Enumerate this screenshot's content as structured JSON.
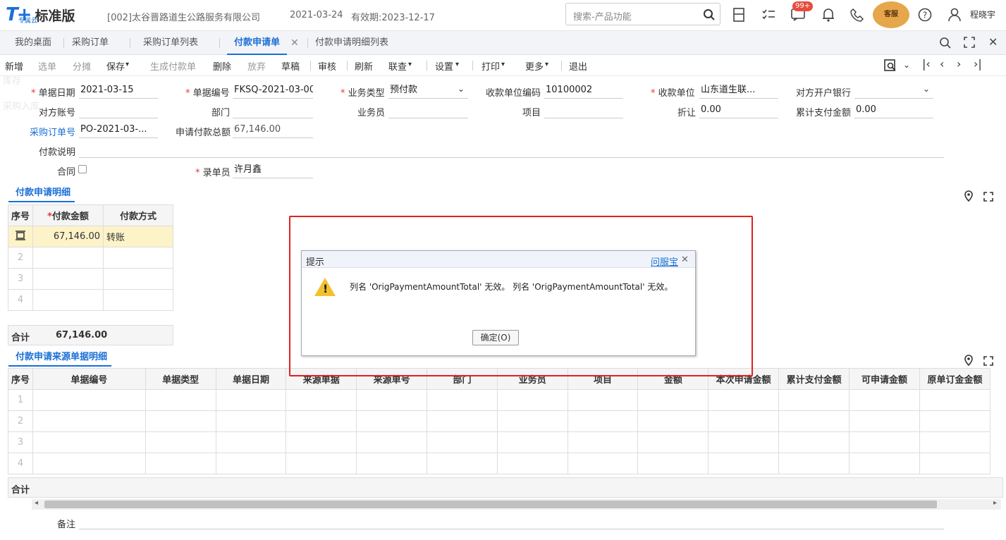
{
  "header": {
    "logo": "T+",
    "logo_sub": "专属云",
    "edition": "标准版",
    "company": "[002]太谷晋路道生公路服务有限公司",
    "date": "2021-03-24",
    "validity": "有效期:2023-12-17",
    "search_placeholder": "搜索-产品功能",
    "badge": "99+",
    "mascot": "客服",
    "user": "程晓宇"
  },
  "tabs": [
    "我的桌面",
    "采购订单",
    "采购订单列表",
    "付款申请单",
    "付款申请明细列表"
  ],
  "toolbar": [
    "新增",
    "选单",
    "分摊",
    "保存",
    "生成付款单",
    "删除",
    "放弃",
    "草稿",
    "审核",
    "刷新",
    "联查",
    "设置",
    "打印",
    "更多",
    "退出"
  ],
  "form": {
    "date_l": "单据日期",
    "date_v": "2021-03-15",
    "no_l": "单据编号",
    "no_v": "FKSQ-2021-03-00...",
    "biz_l": "业务类型",
    "biz_v": "预付款",
    "payee_code_l": "收款单位编码",
    "payee_code_v": "10100002",
    "payee_l": "收款单位",
    "payee_v": "山东道生联...",
    "bank_l": "对方开户银行",
    "bank_v": "",
    "acct_l": "对方账号",
    "dept_l": "部门",
    "staff_l": "业务员",
    "proj_l": "项目",
    "disc_l": "折让",
    "disc_v": "0.00",
    "cum_l": "累计支付金额",
    "cum_v": "0.00",
    "po_l": "采购订单号",
    "po_v": "PO-2021-03-...",
    "total_l": "申请付款总额",
    "total_v": "67,146.00",
    "note_l": "付款说明",
    "contract_l": "合同",
    "entry_l": "录单员",
    "entry_v": "许月鑫"
  },
  "detail": {
    "title": "付款申请明细",
    "headers": [
      "序号",
      "付款金额",
      "付款方式"
    ],
    "rows": [
      {
        "no": "",
        "amt": "67,146.00",
        "way": "转账"
      },
      {
        "no": "2",
        "amt": "",
        "way": ""
      },
      {
        "no": "3",
        "amt": "",
        "way": ""
      },
      {
        "no": "4",
        "amt": "",
        "way": ""
      }
    ],
    "sum_label": "合计",
    "sum_value": "67,146.00"
  },
  "source": {
    "title": "付款申请来源单据明细",
    "headers": [
      "序号",
      "单据编号",
      "单据类型",
      "单据日期",
      "来源单据",
      "来源单号",
      "部门",
      "业务员",
      "项目",
      "金额",
      "本次申请金额",
      "累计支付金额",
      "可申请金额",
      "原单订金金额"
    ],
    "rows": [
      "1",
      "2",
      "3",
      "4"
    ],
    "sum_label": "合计"
  },
  "remark_l": "备注",
  "dialog": {
    "title": "提示",
    "help": "问服宝",
    "message": "列名 'OrigPaymentAmountTotal' 无效。 列名 'OrigPaymentAmountTotal' 无效。",
    "ok": "确定(O)"
  }
}
